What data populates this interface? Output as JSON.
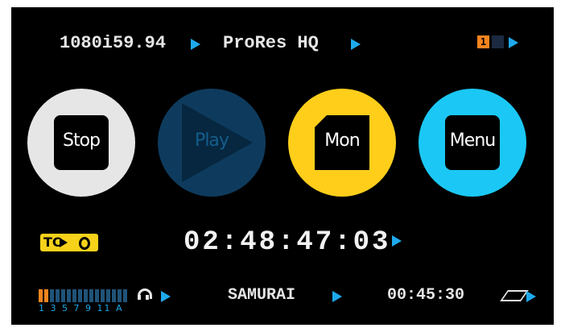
{
  "top_bar": {
    "video_format": "1080i59.94",
    "codec": "ProRes HQ",
    "active_slot": "1"
  },
  "buttons": {
    "stop": "Stop",
    "play": "Play",
    "monitor": "Mon",
    "menu": "Menu"
  },
  "timecode": {
    "source_badge": "TC",
    "value": "02:48:47:03"
  },
  "bottom_bar": {
    "audio_channel_labels": "1 3 5 7 9 11 A",
    "device_name": "SAMURAI",
    "remaining_time": "00:45:30"
  },
  "colors": {
    "accent_blue": "#1ea9ec",
    "stop_ring": "#e6e6e6",
    "play_ring": "#0e3b5d",
    "mon_ring": "#ffce1b",
    "menu_ring": "#1bc8f5",
    "tc_badge": "#f7d21a",
    "slot_active": "#f5841f"
  }
}
